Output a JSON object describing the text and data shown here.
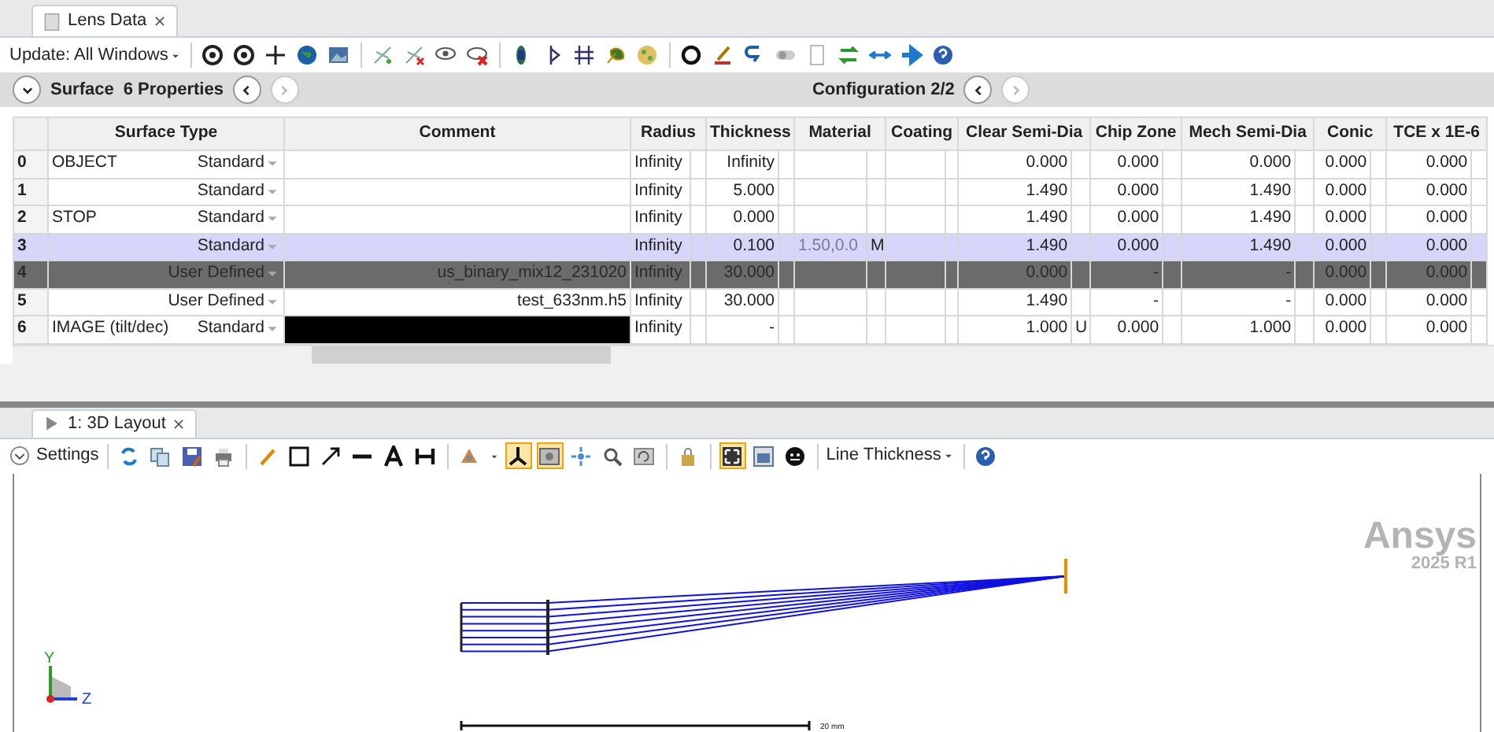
{
  "editor_tabs": [
    {
      "label": "Lens Data",
      "selected": true
    }
  ],
  "editor_toolbar": {
    "update_label": "Update: All Windows"
  },
  "surface_bar": {
    "title": "Surface",
    "properties": "6 Properties",
    "configuration": "Configuration 2/2"
  },
  "table": {
    "columns": [
      "Surface Type",
      "Comment",
      "Radius",
      "Thickness",
      "Material",
      "Coating",
      "Clear Semi-Dia",
      "Chip Zone",
      "Mech Semi-Dia",
      "Conic",
      "TCE x 1E-6"
    ],
    "rows": [
      {
        "index": "0",
        "label": "OBJECT",
        "surface_type": "Standard",
        "comment": "",
        "comment_hidden": false,
        "radius": "Infinity",
        "thickness": "Infinity",
        "material": "",
        "material_solve": "",
        "coating": "",
        "clear_semi_dia": "0.000",
        "clear_semi_dia_solve": "",
        "chip_zone": "0.000",
        "mech_semi_dia": "0.000",
        "conic": "0.000",
        "tce": "0.000",
        "selected": false,
        "ignored": false
      },
      {
        "index": "1",
        "label": "",
        "surface_type": "Standard",
        "comment": "",
        "comment_hidden": false,
        "radius": "Infinity",
        "thickness": "5.000",
        "material": "",
        "material_solve": "",
        "coating": "",
        "clear_semi_dia": "1.490",
        "clear_semi_dia_solve": "",
        "chip_zone": "0.000",
        "mech_semi_dia": "1.490",
        "conic": "0.000",
        "tce": "0.000",
        "selected": false,
        "ignored": false
      },
      {
        "index": "2",
        "label": "STOP",
        "surface_type": "Standard",
        "comment": "",
        "comment_hidden": false,
        "radius": "Infinity",
        "thickness": "0.000",
        "material": "",
        "material_solve": "",
        "coating": "",
        "clear_semi_dia": "1.490",
        "clear_semi_dia_solve": "",
        "chip_zone": "0.000",
        "mech_semi_dia": "1.490",
        "conic": "0.000",
        "tce": "0.000",
        "selected": false,
        "ignored": false
      },
      {
        "index": "3",
        "label": "",
        "surface_type": "Standard",
        "comment": "",
        "comment_hidden": false,
        "radius": "Infinity",
        "thickness": "0.100",
        "material": "1.50,0.0",
        "material_solve": "M",
        "coating": "",
        "clear_semi_dia": "1.490",
        "clear_semi_dia_solve": "",
        "chip_zone": "0.000",
        "mech_semi_dia": "1.490",
        "conic": "0.000",
        "tce": "0.000",
        "selected": true,
        "ignored": false
      },
      {
        "index": "4",
        "label": "",
        "surface_type": "User Defined",
        "comment": "us_binary_mix12_231020",
        "comment_hidden": false,
        "radius": "Infinity",
        "thickness": "30.000",
        "material": "",
        "material_solve": "",
        "coating": "",
        "clear_semi_dia": "0.000",
        "clear_semi_dia_solve": "",
        "chip_zone": "-",
        "mech_semi_dia": "-",
        "conic": "0.000",
        "tce": "0.000",
        "selected": false,
        "ignored": true
      },
      {
        "index": "5",
        "label": "",
        "surface_type": "User Defined",
        "comment": "test_633nm.h5",
        "comment_hidden": false,
        "radius": "Infinity",
        "thickness": "30.000",
        "material": "",
        "material_solve": "",
        "coating": "",
        "clear_semi_dia": "1.490",
        "clear_semi_dia_solve": "",
        "chip_zone": "-",
        "mech_semi_dia": "-",
        "conic": "0.000",
        "tce": "0.000",
        "selected": false,
        "ignored": false
      },
      {
        "index": "6",
        "label": "IMAGE (tilt/dec)",
        "surface_type": "Standard",
        "comment": "",
        "comment_hidden": true,
        "radius": "Infinity",
        "thickness": "-",
        "material": "",
        "material_solve": "",
        "coating": "",
        "clear_semi_dia": "1.000",
        "clear_semi_dia_solve": "U",
        "chip_zone": "0.000",
        "mech_semi_dia": "1.000",
        "conic": "0.000",
        "tce": "0.000",
        "selected": false,
        "ignored": false
      }
    ]
  },
  "layout_window": {
    "tab": {
      "label": "1: 3D Layout",
      "selected": true
    },
    "settings_label": "Settings",
    "line_thickness_label": "Line Thickness",
    "toggles": [
      {
        "kind": "axes",
        "on": true
      },
      {
        "kind": "screen",
        "on": true
      },
      {
        "kind": "frame",
        "on": true
      }
    ],
    "axis_y": "Y",
    "axis_z": "Z",
    "scale_label": "20 mm",
    "branding": "Ansys",
    "version": "2025 R1"
  }
}
